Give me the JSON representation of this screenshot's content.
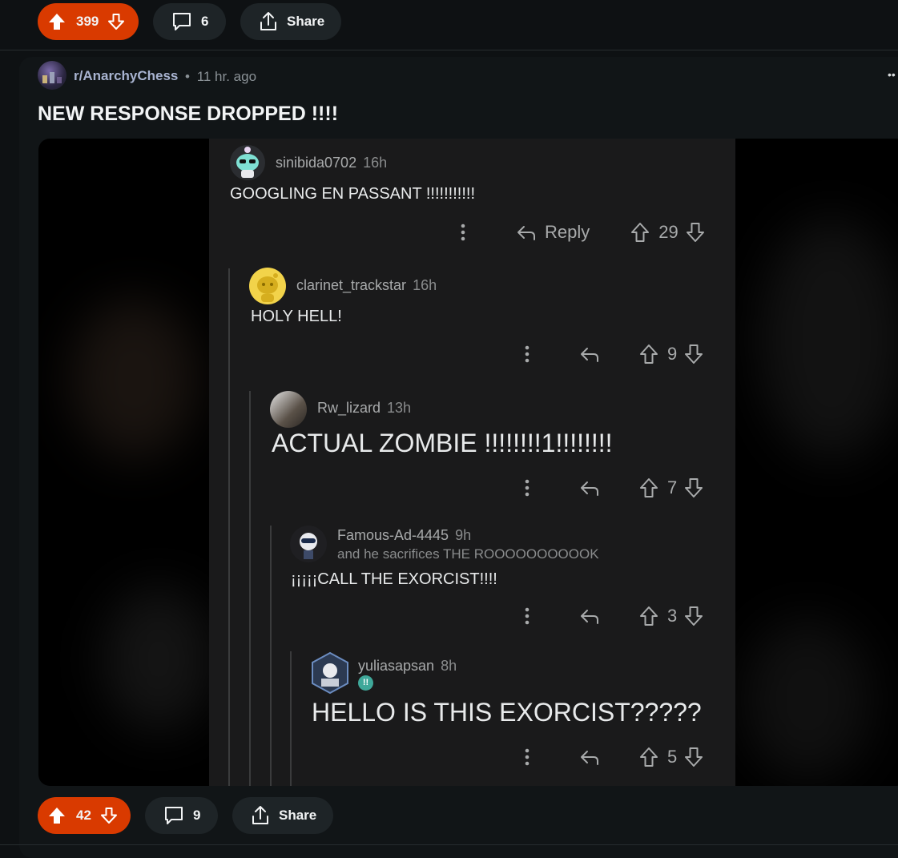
{
  "top_bar": {
    "upvotes": "399",
    "comments": "6",
    "share": "Share"
  },
  "post": {
    "subreddit": "r/AnarchyChess",
    "dot": "•",
    "time": "11 hr. ago",
    "title": "NEW RESPONSE DROPPED !!!!",
    "more": "••"
  },
  "screenshot": {
    "reply_label": "Reply",
    "comments": [
      {
        "user": "sinibida0702",
        "time": "16h",
        "text": "GOOGLING EN PASSANT !!!!!!!!!!!",
        "votes": "29"
      },
      {
        "user": "clarinet_trackstar",
        "time": "16h",
        "text": "HOLY HELL!",
        "votes": "9"
      },
      {
        "user": "Rw_lizard",
        "time": "13h",
        "text": "ACTUAL ZOMBIE !!!!!!!!1!!!!!!!!",
        "votes": "7"
      },
      {
        "user": "Famous-Ad-4445",
        "time": "9h",
        "flair": "and he sacrifices THE ROOOOOOOOOOK",
        "text": "¡¡¡¡¡CALL THE EXORCIST!!!!",
        "votes": "3"
      },
      {
        "user": "yuliasapsan",
        "time": "8h",
        "badge": "!!",
        "text": "HELLO IS THIS EXORCIST?????",
        "votes": "5"
      }
    ]
  },
  "bottom_bar": {
    "upvotes": "42",
    "comments": "9",
    "share": "Share"
  },
  "colors": {
    "upvote_active": "#d93a00",
    "pill_dark": "#1e2427",
    "background": "#0e1113"
  }
}
